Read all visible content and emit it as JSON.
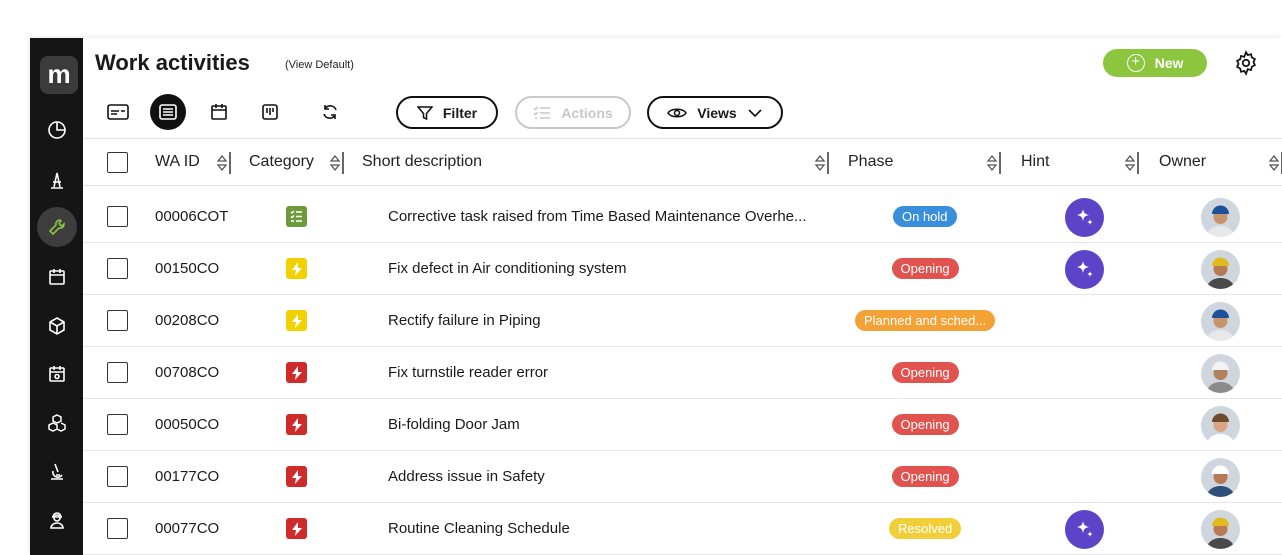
{
  "app": {
    "logo_letter": "m"
  },
  "header": {
    "title": "Work activities",
    "view": "(View Default)",
    "new_label": "New"
  },
  "toolbar": {
    "filter_label": "Filter",
    "actions_label": "Actions",
    "views_label": "Views"
  },
  "columns": {
    "wa_id": "WA ID",
    "category": "Category",
    "short_description": "Short description",
    "phase": "Phase",
    "hint": "Hint",
    "owner": "Owner"
  },
  "rows": [
    {
      "id": "00006COT",
      "category_icon": "checklist-icon",
      "category_color": "#6e9a3a",
      "description": "Corrective task raised from Time Based Maintenance Overhe...",
      "phase": "On hold",
      "phase_color": "#3a8fdc",
      "hint": true,
      "owner": "worker-blue-helmet"
    },
    {
      "id": "00150CO",
      "category_icon": "lightning-icon",
      "category_color": "#f2d100",
      "description": "Fix defect in Air conditioning system",
      "phase": "Opening",
      "phase_color": "#e0534f",
      "hint": true,
      "owner": "worker-yellow-helmet"
    },
    {
      "id": "00208CO",
      "category_icon": "lightning-icon",
      "category_color": "#f2d100",
      "description": "Rectify failure in Piping",
      "phase": "Planned and sched...",
      "phase_color": "#f4a236",
      "hint": false,
      "owner": "worker-blue-helmet"
    },
    {
      "id": "00708CO",
      "category_icon": "lightning-icon",
      "category_color": "#cf2b2b",
      "description": "Fix turnstile reader error",
      "phase": "Opening",
      "phase_color": "#e0534f",
      "hint": false,
      "owner": "worker-woman-helmet"
    },
    {
      "id": "00050CO",
      "category_icon": "lightning-icon",
      "category_color": "#cf2b2b",
      "description": "Bi-folding Door Jam",
      "phase": "Opening",
      "phase_color": "#e0534f",
      "hint": false,
      "owner": "worker-woman-short-hair"
    },
    {
      "id": "00177CO",
      "category_icon": "lightning-icon",
      "category_color": "#cf2b2b",
      "description": "Address issue in Safety",
      "phase": "Opening",
      "phase_color": "#e0534f",
      "hint": false,
      "owner": "worker-woman-helmet-2"
    },
    {
      "id": "00077CO",
      "category_icon": "lightning-icon",
      "category_color": "#cf2b2b",
      "description": "Routine Cleaning Schedule",
      "phase": "Resolved",
      "phase_color": "#f1cf3b",
      "hint": true,
      "owner": "worker-yellow-helmet"
    }
  ]
}
